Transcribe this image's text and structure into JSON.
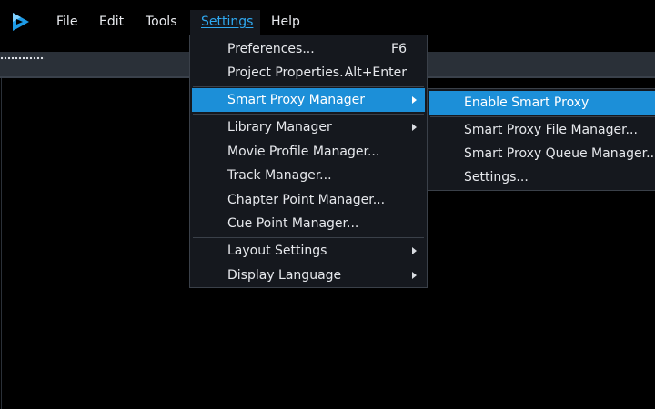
{
  "menubar": {
    "items": [
      {
        "label": "File"
      },
      {
        "label": "Edit"
      },
      {
        "label": "Tools"
      },
      {
        "label": "Settings"
      },
      {
        "label": "Help"
      }
    ]
  },
  "settings_menu": {
    "items": [
      {
        "label": "Preferences...",
        "shortcut": "F6"
      },
      {
        "label": "Project Properties...",
        "shortcut": "Alt+Enter"
      },
      {
        "label": "Smart Proxy Manager"
      },
      {
        "label": "Library Manager"
      },
      {
        "label": "Movie Profile Manager..."
      },
      {
        "label": "Track Manager..."
      },
      {
        "label": "Chapter Point Manager..."
      },
      {
        "label": "Cue Point Manager..."
      },
      {
        "label": "Layout Settings"
      },
      {
        "label": "Display Language"
      }
    ]
  },
  "smart_proxy_submenu": {
    "items": [
      {
        "label": "Enable Smart Proxy"
      },
      {
        "label": "Smart Proxy File Manager..."
      },
      {
        "label": "Smart Proxy Queue Manager..."
      },
      {
        "label": "Settings..."
      }
    ]
  },
  "icons": {
    "app_logo": "play-logo-icon",
    "submenu_arrow": "chevron-right-icon"
  },
  "colors": {
    "accent": "#2fa8ef",
    "highlight": "#1c8fd8",
    "menu_background": "#15181e",
    "app_background": "#000000"
  }
}
